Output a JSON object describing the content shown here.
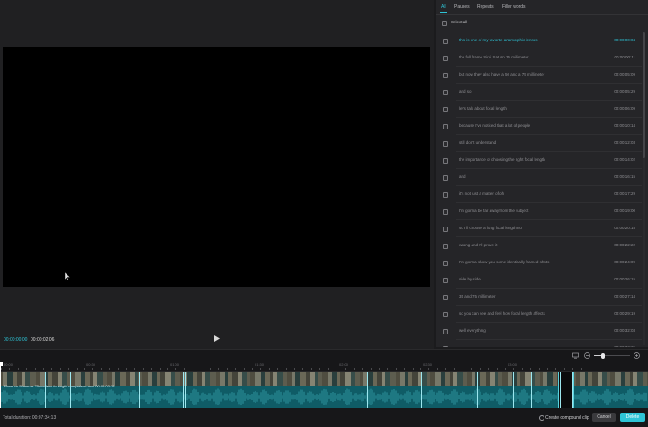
{
  "preview": {
    "timecode_current": "00:00:00:00",
    "timecode_total": "00:00:02:06"
  },
  "transcript": {
    "tabs": [
      {
        "label": "All"
      },
      {
        "label": "Pauses"
      },
      {
        "label": "Repeats"
      },
      {
        "label": "Filler words"
      }
    ],
    "select_all_label": "Select all",
    "rows": [
      {
        "text": "this is one of my favorite anamorphic lenses",
        "time": "00:00:00:04",
        "active": true
      },
      {
        "text": "the full frame Sirui Saturn 35 millimeter",
        "time": "00:00:00:11",
        "active": false
      },
      {
        "text": "but now they also have a 50 and a 75 millimeter",
        "time": "00:00:05:09",
        "active": false
      },
      {
        "text": "and so",
        "time": "00:00:05:29",
        "active": false
      },
      {
        "text": "let's talk about focal length",
        "time": "00:00:06:09",
        "active": false
      },
      {
        "text": "because I've noticed that a lot of people",
        "time": "00:00:10:14",
        "active": false
      },
      {
        "text": "still don't understand",
        "time": "00:00:12:03",
        "active": false
      },
      {
        "text": "the importance of choosing the right focal length",
        "time": "00:00:14:02",
        "active": false
      },
      {
        "text": "and",
        "time": "00:00:16:15",
        "active": false
      },
      {
        "text": "it's not just a matter of oh",
        "time": "00:00:17:29",
        "active": false
      },
      {
        "text": "I'm gonna be far away from the subject",
        "time": "00:00:19:00",
        "active": false
      },
      {
        "text": "so I'll choose a long focal length no",
        "time": "00:00:20:15",
        "active": false
      },
      {
        "text": "wrong and I'll prove it",
        "time": "00:00:22:22",
        "active": false
      },
      {
        "text": "I'm gonna show you some identically framed shots",
        "time": "00:00:24:09",
        "active": false
      },
      {
        "text": "side by side",
        "time": "00:00:26:15",
        "active": false
      },
      {
        "text": "35 and 75 millimeter",
        "time": "00:00:27:14",
        "active": false
      },
      {
        "text": "so you can see and feel how focal length affects",
        "time": "00:00:29:19",
        "active": false
      },
      {
        "text": "well everything",
        "time": "00:00:32:03",
        "active": false
      },
      {
        "text": "",
        "time": "00:00:33:25",
        "active": false
      }
    ]
  },
  "timeline": {
    "ruler_ticks": [
      "00:00",
      "00:30",
      "01:00",
      "01:30",
      "02:00",
      "02:30",
      "03:00"
    ],
    "clip_label": "35mm vs 55mm vs 75mm lens fo   length comparison.mov   00:06:03:29"
  },
  "footer": {
    "total_duration_label": "Total duration:",
    "total_duration_value": "00:07:34:13",
    "compound_label": "Create compound clip",
    "cancel_label": "Cancel",
    "delete_label": "Delete"
  },
  "colors": {
    "accent": "#2ec4d6",
    "track": "#0f5c66"
  }
}
